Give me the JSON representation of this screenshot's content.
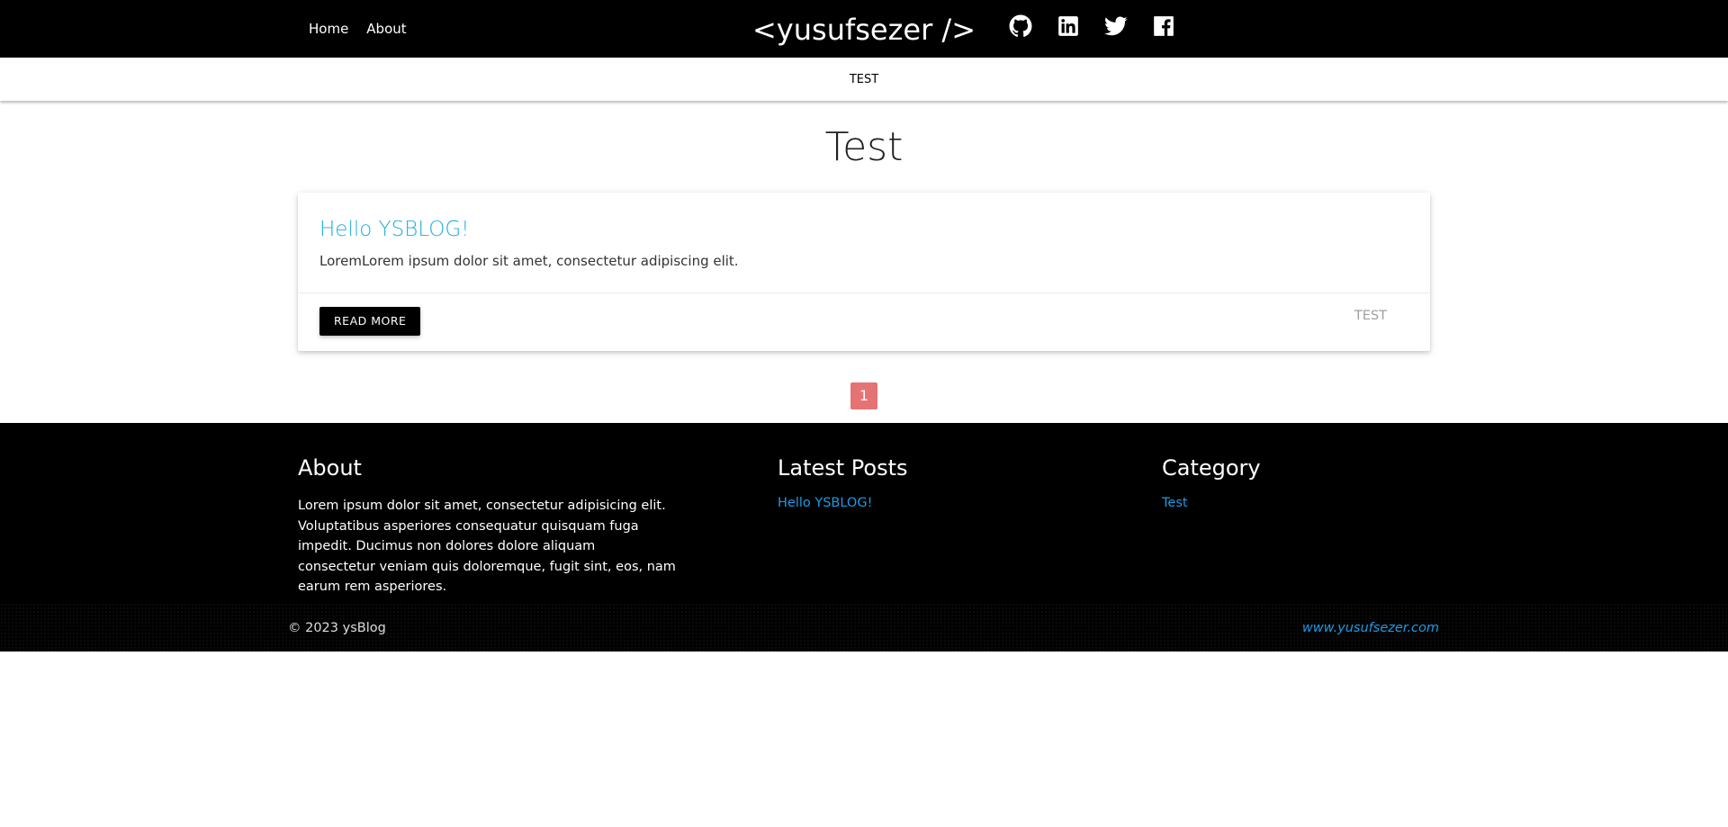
{
  "nav": {
    "links": [
      {
        "label": "Home"
      },
      {
        "label": "About"
      }
    ],
    "brand": "<yusufsezer />",
    "socials": [
      "github-icon",
      "linkedin-icon",
      "twitter-icon",
      "facebook-icon"
    ]
  },
  "subnav": {
    "category": "TEST"
  },
  "main": {
    "title": "Test",
    "posts": [
      {
        "title": "Hello YSBLOG!",
        "excerpt": "LoremLorem ipsum dolor sit amet, consectetur adipiscing elit.",
        "button": "READ MORE",
        "tag": "TEST"
      }
    ],
    "pagination": {
      "current": "1"
    }
  },
  "footer": {
    "about": {
      "heading": "About",
      "text": "Lorem ipsum dolor sit amet, consectetur adipisicing elit. Voluptatibus asperiores consequatur quisquam fuga impedit. Ducimus non dolores dolore aliquam consectetur veniam quis doloremque, fugit sint, eos, nam earum rem asperiores."
    },
    "latest_posts": {
      "heading": "Latest Posts",
      "items": [
        "Hello YSBLOG!"
      ]
    },
    "category": {
      "heading": "Category",
      "items": [
        "Test"
      ]
    },
    "copyright": "© 2023 ysBlog",
    "site_link": "www.yusufsezer.com"
  },
  "colors": {
    "nav_bg": "#000000",
    "link_blue": "#1eaedb",
    "pagination_active": "#e57373"
  }
}
